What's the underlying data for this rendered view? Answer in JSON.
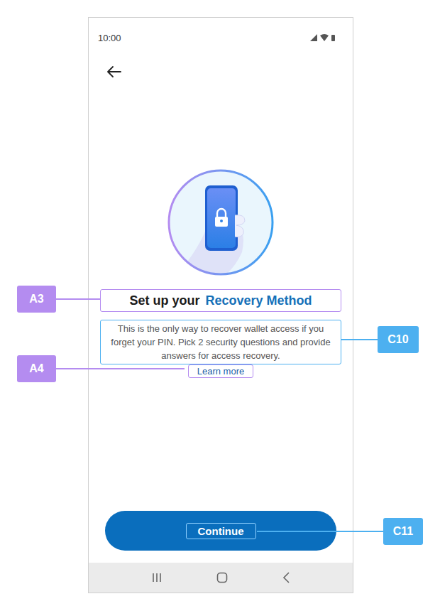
{
  "status_bar": {
    "time": "10:00"
  },
  "title": {
    "prefix": "Set up your",
    "highlight": "Recovery Method",
    "annotation": {
      "label": "A3",
      "color": "#b48cf0"
    }
  },
  "description": {
    "text": "This is the only way to recover wallet access if you forget your PIN. Pick 2 security questions and provide answers for access recovery.",
    "annotation": {
      "label": "C10",
      "color": "#4db0f0"
    }
  },
  "link": {
    "text": "Learn more",
    "annotation": {
      "label": "A4",
      "color": "#b48cf0"
    }
  },
  "button": {
    "text": "Continue",
    "annotation": {
      "label": "C11",
      "color": "#4db0f0"
    }
  }
}
